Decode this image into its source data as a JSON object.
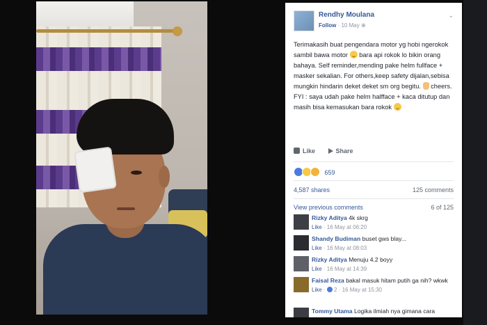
{
  "post": {
    "author": "Rendhy Moulana",
    "follow_label": "Follow",
    "date": "10 May",
    "separator": "·",
    "text_p1": "Terimakasih buat pengendara motor yg hobi ngerokok sambil bawa motor",
    "text_p2": "bara api rokok lo bikin orang bahaya. Self reminder,mending pake helm fullface + masker sekalian. For others,keep safety dijalan,sebisa mungkin hindarin deket deket sm org begitu.",
    "text_p3": "cheers. FYI : saya udah pake helm halfface + kaca ditutup dan masih bisa kemasukan bara rokok"
  },
  "actions": {
    "like_label": "Like",
    "share_label": "Share"
  },
  "stats": {
    "reaction_count": "659",
    "shares": "4,587 shares",
    "comments": "125 comments"
  },
  "comments_header": {
    "view_previous": "View previous comments",
    "count": "6 of 125"
  },
  "comments": [
    {
      "name": "Rizky Aditya",
      "text": "4k skrg",
      "like": "Like",
      "time": "16 May at 06:20"
    },
    {
      "name": "Shandy Budiman",
      "text": "buset gws blay...",
      "like": "Like",
      "time": "16 May at 08:03"
    },
    {
      "name": "Rizky Aditya",
      "text": "Menuju 4.2 boyy",
      "like": "Like",
      "time": "16 May at 14:39"
    },
    {
      "name": "Faisal Reza",
      "text": "bakal masuk hitam putih ga nih? wkwk",
      "like": "Like",
      "reacts": "2",
      "time": "16 May at 15:30"
    },
    {
      "name": "Tommy Utama",
      "text": "Logika ilmiah nya gimana cara",
      "like": "",
      "time": ""
    }
  ],
  "colors": {
    "link": "#365899",
    "background": "#0b0b0c",
    "panel": "#ffffff"
  },
  "icons": [
    "photo",
    "avatar",
    "chevron-down-icon",
    "like-icon",
    "share-icon",
    "smile-emoji",
    "victory-hand-emoji",
    "reaction-like-icon",
    "reaction-haha-icon",
    "reaction-sad-icon"
  ]
}
